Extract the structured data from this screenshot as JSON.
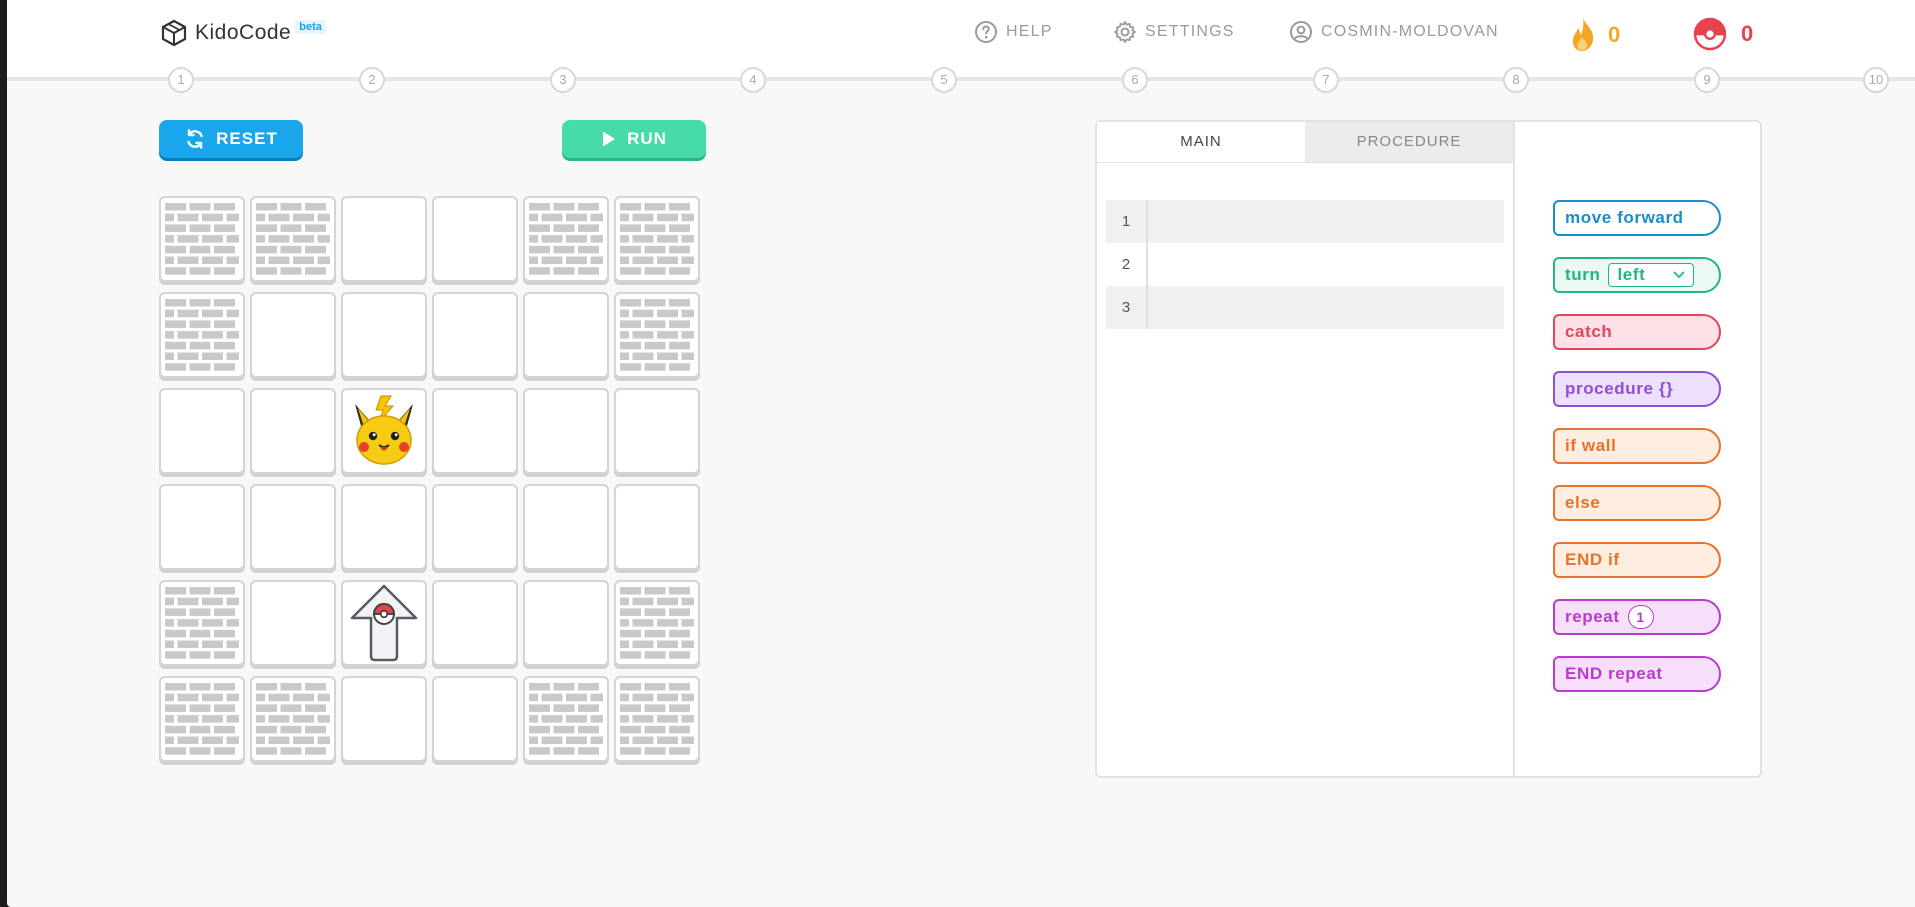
{
  "brand": {
    "name": "KidoCode",
    "tag": "beta"
  },
  "nav": {
    "help": "HELP",
    "settings": "SETTINGS",
    "user": "COSMIN-MOLDOVAN"
  },
  "counters": {
    "fire": "0",
    "pokeball": "0"
  },
  "colors": {
    "fire": "#f5a623",
    "pokeball": "#e8424f",
    "reset": "#19a6ea",
    "run": "#46dba9"
  },
  "steps": [
    "1",
    "2",
    "3",
    "4",
    "5",
    "6",
    "7",
    "8",
    "9",
    "10"
  ],
  "buttons": {
    "reset": "RESET",
    "run": "RUN"
  },
  "board": {
    "legend": {
      "W": "brick-wall",
      "_": "empty",
      "P": "pikachu-target",
      "A": "pokeball-player-facing-up"
    },
    "rows": [
      [
        "W",
        "W",
        "_",
        "_",
        "W",
        "W"
      ],
      [
        "W",
        "_",
        "_",
        "_",
        "_",
        "W"
      ],
      [
        "_",
        "_",
        "P",
        "_",
        "_",
        "_"
      ],
      [
        "_",
        "_",
        "_",
        "_",
        "_",
        "_"
      ],
      [
        "W",
        "_",
        "A",
        "_",
        "_",
        "W"
      ],
      [
        "W",
        "W",
        "_",
        "_",
        "W",
        "W"
      ]
    ]
  },
  "editor": {
    "tabs": [
      {
        "label": "MAIN",
        "active": true
      },
      {
        "label": "PROCEDURE",
        "active": false
      }
    ],
    "lines": [
      "1",
      "2",
      "3"
    ]
  },
  "palette": {
    "move": "move forward",
    "turn": "turn",
    "turn_value": "left",
    "catch": "catch",
    "procedure": "procedure {}",
    "if_wall": "if wall",
    "else": "else",
    "end_if": "END if",
    "repeat": "repeat",
    "repeat_count": "1",
    "end_repeat": "END repeat"
  }
}
